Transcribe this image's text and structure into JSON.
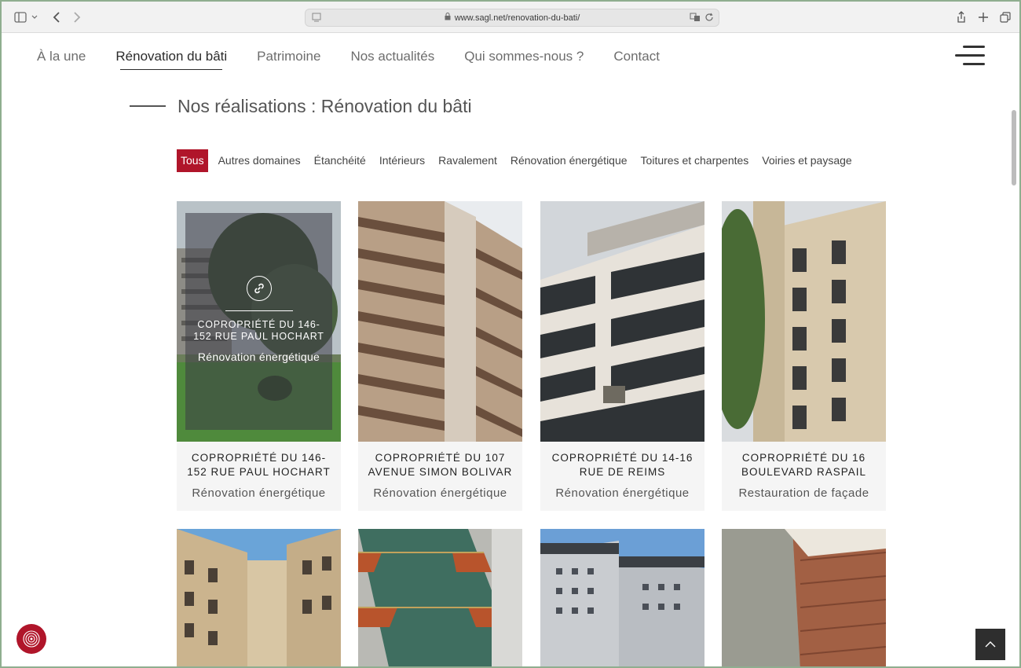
{
  "browser": {
    "url": "www.sagl.net/renovation-du-bati/"
  },
  "nav": {
    "items": [
      {
        "label": "À la une"
      },
      {
        "label": "Rénovation du bâti"
      },
      {
        "label": "Patrimoine"
      },
      {
        "label": "Nos actualités"
      },
      {
        "label": "Qui sommes-nous ?"
      },
      {
        "label": "Contact"
      }
    ],
    "active_index": 1
  },
  "section": {
    "title": "Nos réalisations : Rénovation du bâti"
  },
  "filters": [
    {
      "label": "Tous"
    },
    {
      "label": "Autres domaines"
    },
    {
      "label": "Étanchéité"
    },
    {
      "label": "Intérieurs"
    },
    {
      "label": "Ravalement"
    },
    {
      "label": "Rénovation énergétique"
    },
    {
      "label": "Toitures et charpentes"
    },
    {
      "label": "Voiries et paysage"
    }
  ],
  "projects": [
    {
      "title": "Copropriété du 146-152 rue Paul Hochart",
      "category": "Rénovation énergétique"
    },
    {
      "title": "Copropriété du 107 avenue Simon Bolivar",
      "category": "Rénovation énergétique"
    },
    {
      "title": "Copropriété du 14-16 rue de Reims",
      "category": "Rénovation énergétique"
    },
    {
      "title": "Copropriété du 16 boulevard Raspail",
      "category": "Restauration de façade"
    }
  ],
  "colors": {
    "accent": "#b0152a",
    "dark": "#2e2e2e"
  }
}
